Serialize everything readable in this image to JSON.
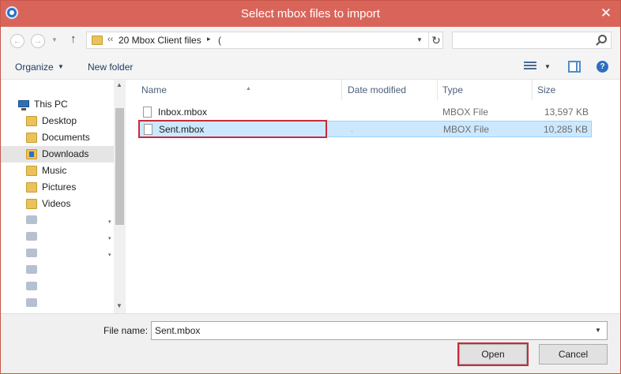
{
  "window": {
    "title": "Select mbox files to import",
    "close_glyph": "✕"
  },
  "addressbar": {
    "back_glyph": "←",
    "forward_glyph": "→",
    "up_glyph": "↑",
    "chevron": "‹‹",
    "segment": "20 Mbox Client files",
    "segment_arrow": "▸",
    "more": "(",
    "refresh_glyph": "↻",
    "dropdown_glyph": "▼"
  },
  "search": {
    "placeholder": ""
  },
  "toolbar": {
    "organize_label": "Organize",
    "organize_arrow": "▼",
    "new_folder_label": "New folder",
    "views_arrow": "▼",
    "help_glyph": "?"
  },
  "nav": {
    "items": [
      {
        "label": "This PC",
        "icon": "computer-icon"
      },
      {
        "label": "Desktop",
        "icon": "folder-icon"
      },
      {
        "label": "Documents",
        "icon": "folder-icon"
      },
      {
        "label": "Downloads",
        "icon": "downloads-folder-icon"
      },
      {
        "label": "Music",
        "icon": "folder-icon"
      },
      {
        "label": "Pictures",
        "icon": "folder-icon"
      },
      {
        "label": "Videos",
        "icon": "folder-icon"
      }
    ],
    "scroll_up": "▲",
    "scroll_down": "▼",
    "chevron": "▾"
  },
  "columns": {
    "name": "Name",
    "date_modified": "Date modified",
    "type": "Type",
    "size": "Size",
    "sort_glyph": "▲"
  },
  "files": [
    {
      "name": "Inbox.mbox",
      "date": "",
      "type": "MBOX File",
      "size": "13,597 KB"
    },
    {
      "name": "Sent.mbox",
      "date": ".",
      "type": "MBOX File",
      "size": "10,285 KB"
    }
  ],
  "footer": {
    "file_name_label": "File name:",
    "file_name_value": "Sent.mbox",
    "dropdown_glyph": "▼",
    "open_label": "Open",
    "cancel_label": "Cancel"
  },
  "colors": {
    "titlebar": "#d9655a",
    "selection": "#cce8ff",
    "highlight_outline": "#c92a3a"
  }
}
